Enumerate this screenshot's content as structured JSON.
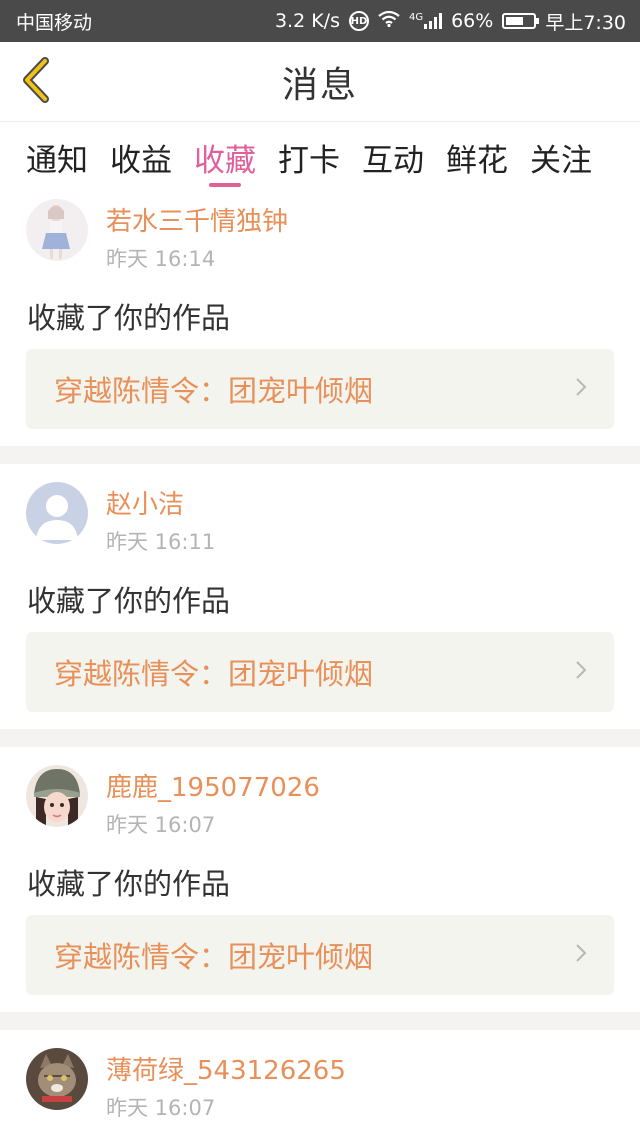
{
  "status_bar": {
    "carrier": "中国移动",
    "speed": "3.2 K/s",
    "hd_badge": "HD",
    "network": "4G",
    "battery_percent": "66%",
    "battery_level": 0.66,
    "time": "早上7:30"
  },
  "header": {
    "back_icon": "chevron-left-icon",
    "title": "消息"
  },
  "tabs": [
    {
      "label": "通知",
      "active": false
    },
    {
      "label": "收益",
      "active": false
    },
    {
      "label": "收藏",
      "active": true
    },
    {
      "label": "打卡",
      "active": false
    },
    {
      "label": "互动",
      "active": false
    },
    {
      "label": "鲜花",
      "active": false
    },
    {
      "label": "关注",
      "active": false
    }
  ],
  "colors": {
    "accent_pink": "#e0609c",
    "username_orange": "#e8905a",
    "card_bg": "#f4f4ef"
  },
  "messages": [
    {
      "username": "若水三千情独钟",
      "time": "昨天 16:14",
      "action": "收藏了你的作品",
      "work_title": "穿越陈情令：团宠叶倾烟",
      "avatar": "girl-avatar"
    },
    {
      "username": "赵小洁",
      "time": "昨天 16:11",
      "action": "收藏了你的作品",
      "work_title": "穿越陈情令：团宠叶倾烟",
      "avatar": "default-avatar"
    },
    {
      "username": "鹿鹿_195077026",
      "time": "昨天 16:07",
      "action": "收藏了你的作品",
      "work_title": "穿越陈情令：团宠叶倾烟",
      "avatar": "girl-hat-avatar"
    },
    {
      "username": "薄荷绿_543126265",
      "time": "昨天 16:07",
      "avatar": "cat-avatar"
    }
  ]
}
